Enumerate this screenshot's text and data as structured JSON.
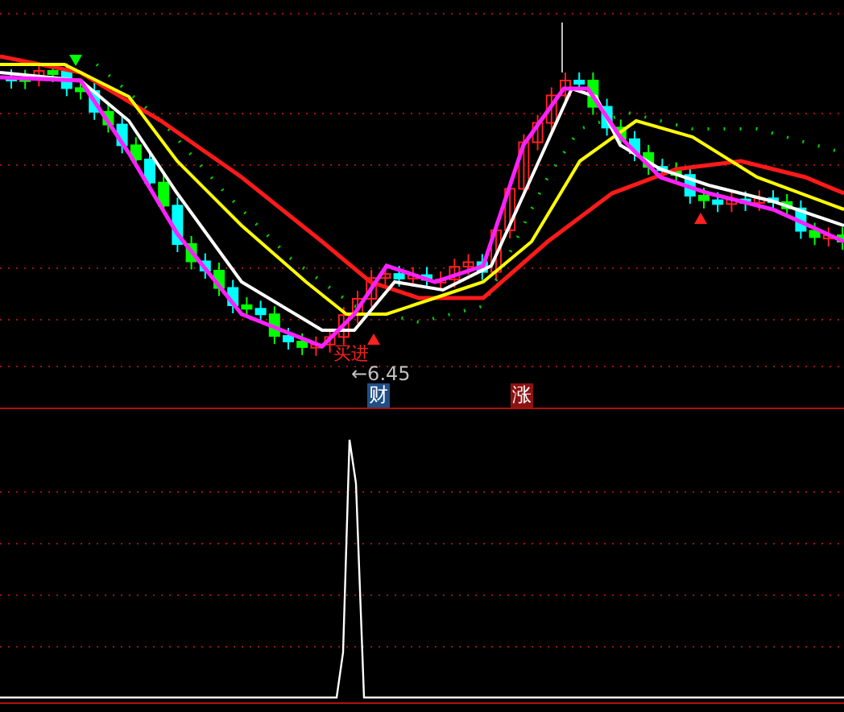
{
  "price_label": "←6.45",
  "signal_label": "买进",
  "markers": [
    {
      "text": "财",
      "color": "#1f4f86"
    },
    {
      "text": "涨",
      "color": "#8c1212"
    }
  ]
}
